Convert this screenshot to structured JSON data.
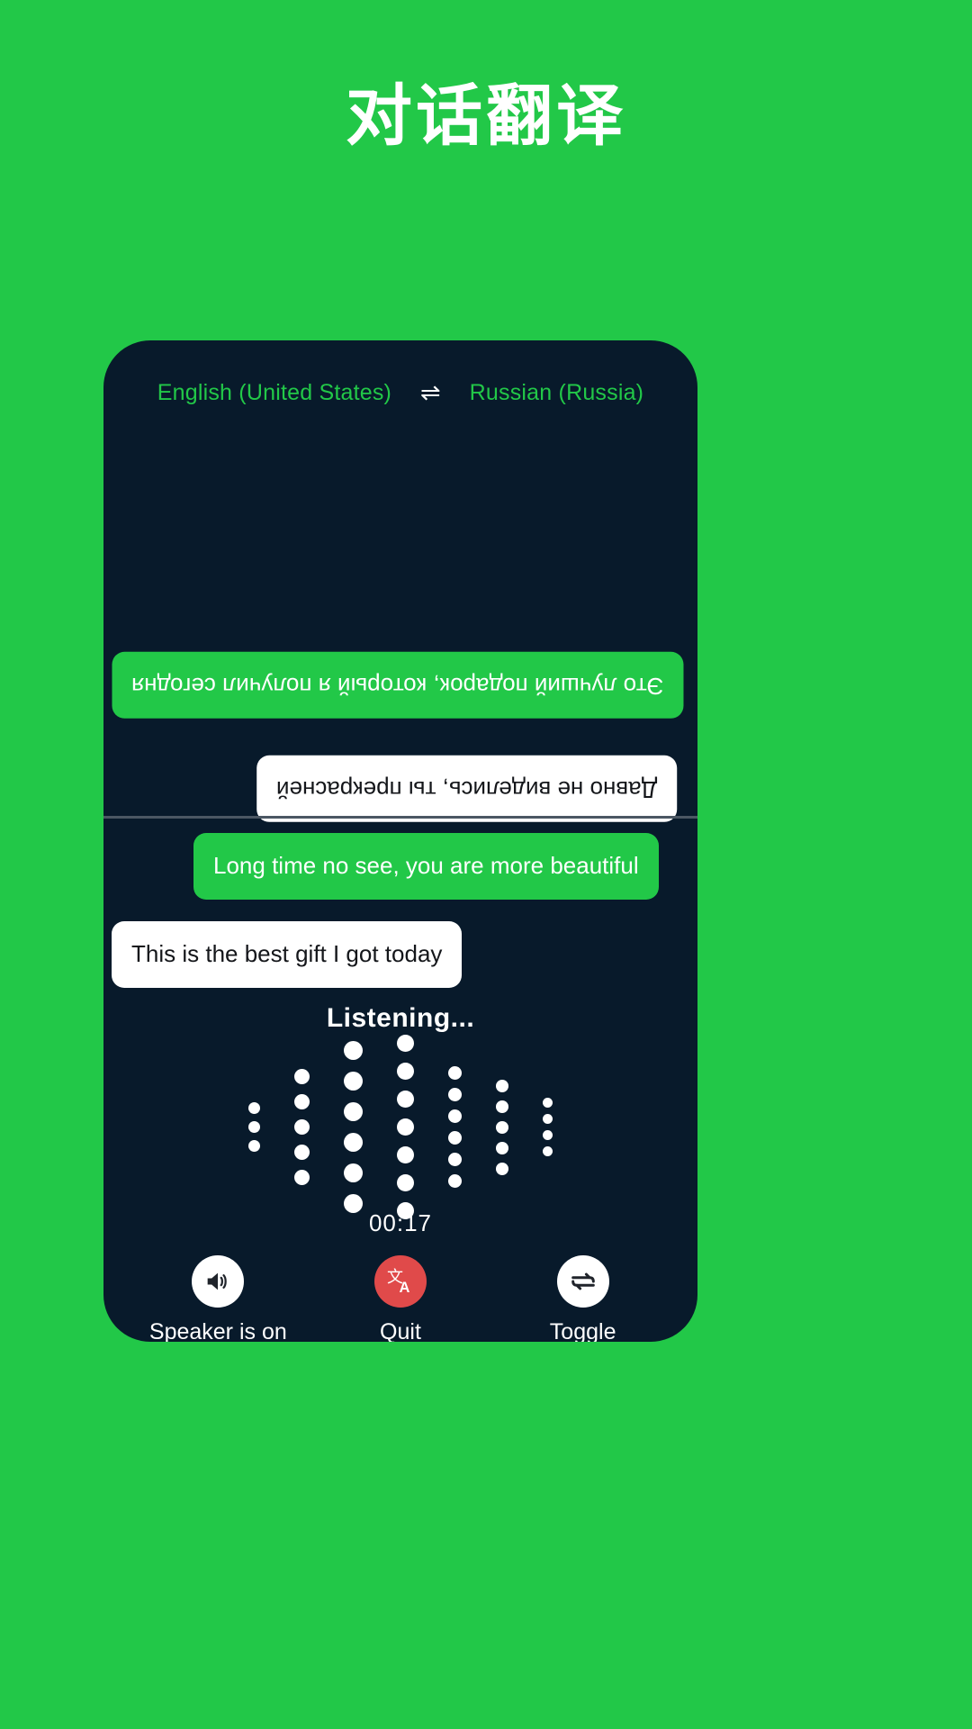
{
  "header": {
    "title": "对话翻译"
  },
  "colors": {
    "background": "#22c848",
    "card": "#081a2b",
    "accent_green": "#22c848",
    "quit_red": "#e04a4a",
    "bubble_white": "#ffffff",
    "divider": "#4b5763"
  },
  "language_bar": {
    "source": "English (United States)",
    "swap_icon": "swap-horizontal-icon",
    "swap_glyph": "⇌",
    "target": "Russian (Russia)"
  },
  "conversation": {
    "remote_pane": {
      "orientation": "rotated-180",
      "messages": [
        {
          "text": "Это лучший подарок, который я получил сегодня",
          "style": "green",
          "align": "left"
        },
        {
          "text": "Давно не виделись, ты прекрасней",
          "style": "white",
          "align": "right"
        }
      ]
    },
    "local_pane": {
      "orientation": "normal",
      "messages": [
        {
          "text": "Long time no see, you are more beautiful",
          "style": "green",
          "align": "right"
        },
        {
          "text": "This is the best gift I got today",
          "style": "white",
          "align": "left"
        }
      ]
    }
  },
  "status": {
    "listening_label": "Listening...",
    "timer": "00:17"
  },
  "waveform": {
    "dot_color": "#ffffff",
    "columns": [
      {
        "count": 3,
        "size": 13
      },
      {
        "count": 5,
        "size": 17
      },
      {
        "count": 6,
        "size": 21
      },
      {
        "count": 7,
        "size": 19
      },
      {
        "count": 6,
        "size": 15
      },
      {
        "count": 5,
        "size": 14
      },
      {
        "count": 4,
        "size": 11
      }
    ]
  },
  "controls": [
    {
      "label": "Speaker is on",
      "icon": "speaker-on-icon",
      "circle": "light",
      "name": "speaker-toggle-button"
    },
    {
      "label": "Quit",
      "icon": "translate-icon",
      "circle": "red",
      "name": "quit-button"
    },
    {
      "label": "Toggle",
      "icon": "swap-loop-icon",
      "circle": "light",
      "name": "toggle-button"
    }
  ]
}
